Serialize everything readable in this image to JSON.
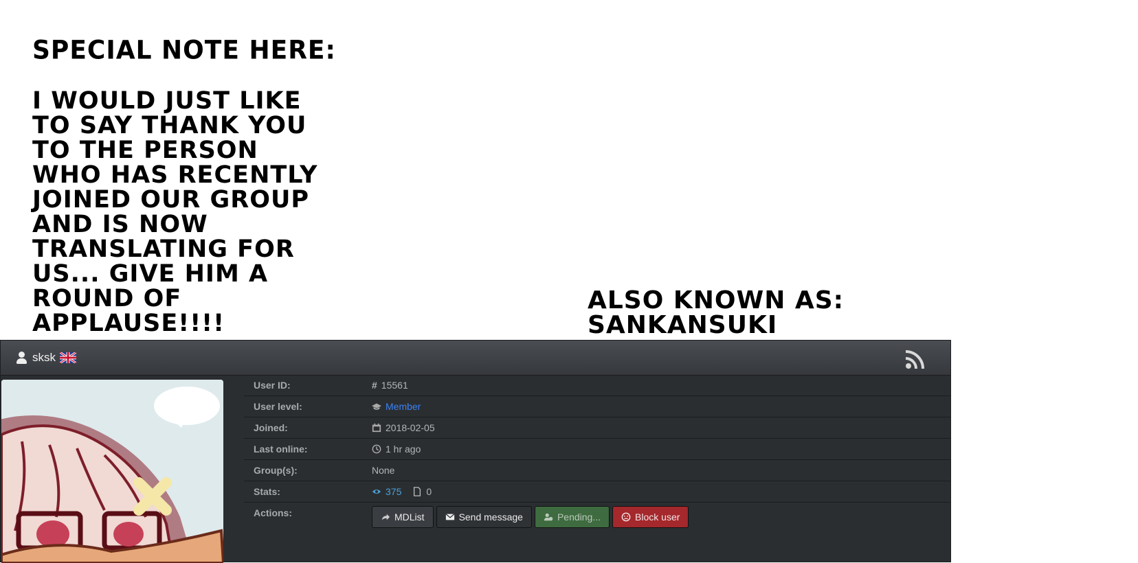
{
  "note": {
    "title": "Special note here:",
    "body": " I would just like\nto say thank you\nto the person\nwho has recently\njoined our group\nand is now\ntranslating for\nus... give him a\nround of\napplause!!!!",
    "aka": "Also known as:\nsankansuki"
  },
  "profile": {
    "username": "sksk",
    "rows": {
      "user_id": {
        "label": "User ID:",
        "value": "15561"
      },
      "user_level": {
        "label": "User level:",
        "value": "Member"
      },
      "joined": {
        "label": "Joined:",
        "value": "2018-02-05"
      },
      "last_online": {
        "label": "Last online:",
        "value": "1 hr ago"
      },
      "groups": {
        "label": "Group(s):",
        "value": "None"
      },
      "stats": {
        "label": "Stats:",
        "views": "375",
        "uploads": "0"
      },
      "actions": {
        "label": "Actions:"
      }
    },
    "buttons": {
      "mdlist": "MDList",
      "send_message": "Send message",
      "pending": "Pending...",
      "block": "Block user"
    }
  },
  "colors": {
    "panel_bg": "#2b2e31",
    "link": "#3b82f6",
    "block_red": "#a4282c",
    "pending_green": "#3e6b3f"
  }
}
